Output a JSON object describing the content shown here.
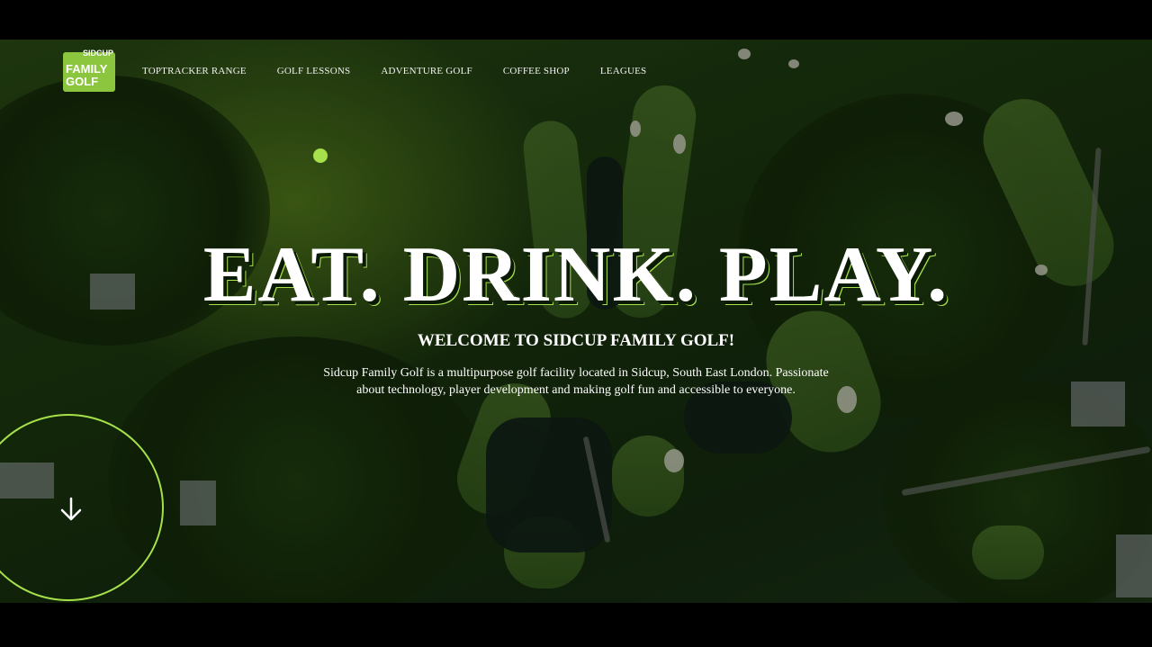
{
  "brand": {
    "logo_top": "SIDCUP",
    "logo_mid": "FAMILY",
    "logo_bot": "GOLF",
    "accent_color": "#a6e04a",
    "logo_bg": "#8cc63f"
  },
  "nav": {
    "items": [
      {
        "label": "TOPTRACKER RANGE"
      },
      {
        "label": "GOLF LESSONS"
      },
      {
        "label": "ADVENTURE GOLF"
      },
      {
        "label": "COFFEE SHOP"
      },
      {
        "label": "LEAGUES"
      }
    ]
  },
  "hero": {
    "headline": "EAT. DRINK. PLAY.",
    "subtitle": "WELCOME TO SIDCUP FAMILY GOLF!",
    "description": "Sidcup Family Golf is a multipurpose golf facility located in Sidcup, South East London. Passionate about technology, player development and making golf fun and accessible to everyone.",
    "scroll_icon": "arrow-down-icon"
  }
}
